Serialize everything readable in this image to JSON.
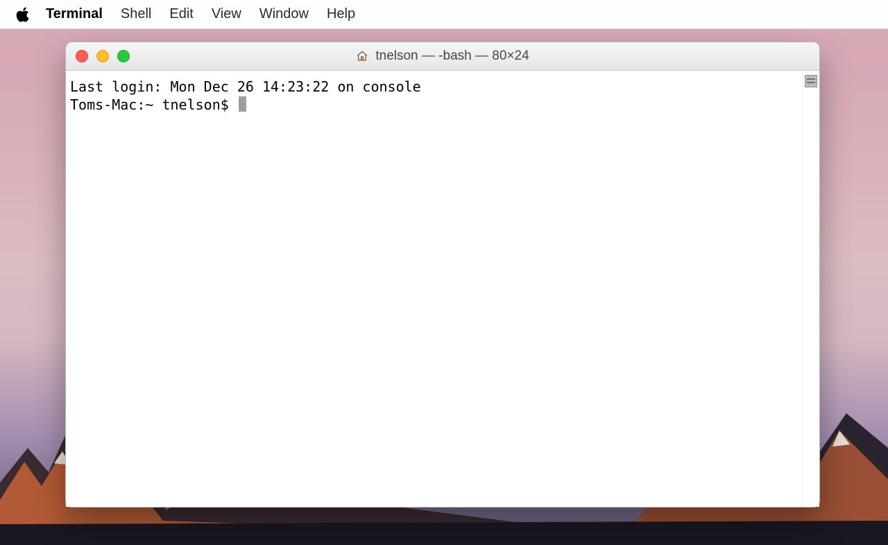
{
  "menubar": {
    "app_name": "Terminal",
    "items": [
      "Shell",
      "Edit",
      "View",
      "Window",
      "Help"
    ]
  },
  "window": {
    "title": "tnelson — -bash — 80×24",
    "last_login_line": "Last login: Mon Dec 26 14:23:22 on console",
    "prompt": "Toms-Mac:~ tnelson$ "
  }
}
